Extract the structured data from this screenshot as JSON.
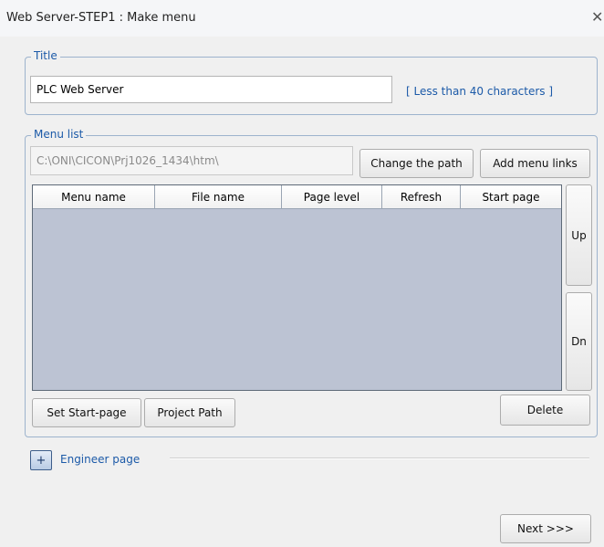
{
  "window": {
    "title": "Web Server-STEP1 : Make menu",
    "close_glyph": "✕"
  },
  "title_group": {
    "legend": "Title",
    "input_value": "PLC Web Server",
    "hint": "[ Less than 40 characters ]"
  },
  "menu_group": {
    "legend": "Menu list",
    "path_value": "C:\\ONI\\CICON\\Prj1026_1434\\htm\\",
    "change_path": "Change the path",
    "add_links": "Add menu links",
    "columns": [
      "Menu name",
      "File name",
      "Page level",
      "Refresh",
      "Start page"
    ],
    "up": "Up",
    "down": "Dn",
    "set_start": "Set Start-page",
    "project_path": "Project Path",
    "delete": "Delete"
  },
  "engineer": {
    "toggle": "+",
    "label": "Engineer page"
  },
  "footer": {
    "next": "Next >>>"
  }
}
